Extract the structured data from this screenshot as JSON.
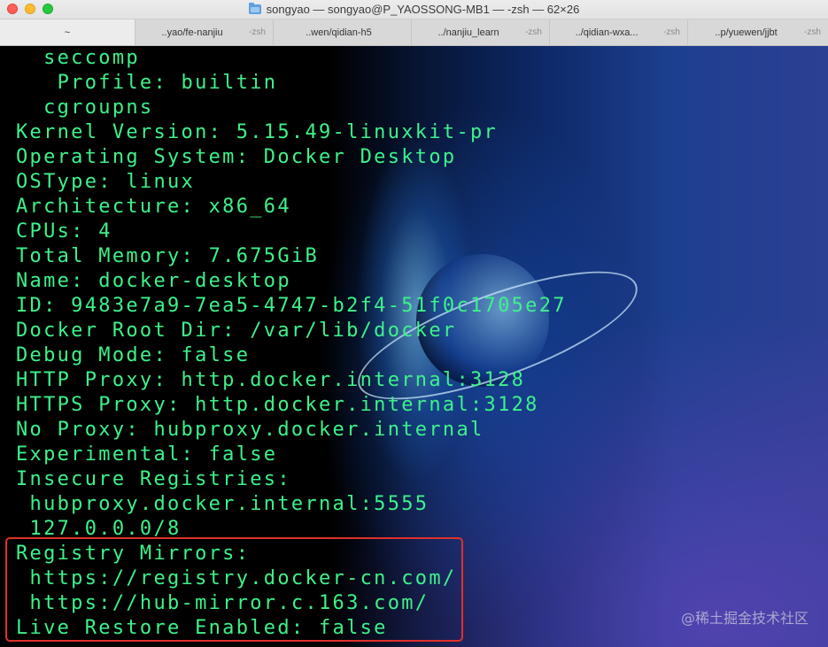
{
  "window": {
    "title": "songyao — songyao@P_YAOSSONG-MB1 — -zsh — 62×26"
  },
  "tabs": [
    {
      "title": "~",
      "shell": ""
    },
    {
      "title": "..yao/fe-nanjiu",
      "shell": "-zsh"
    },
    {
      "title": "..wen/qidian-h5",
      "shell": ""
    },
    {
      "title": "../nanjiu_learn",
      "shell": "-zsh"
    },
    {
      "title": "../qidian-wxa...",
      "shell": "-zsh"
    },
    {
      "title": "..p/yuewen/jjbt",
      "shell": "-zsh"
    }
  ],
  "terminal": {
    "lines": [
      "  seccomp",
      "   Profile: builtin",
      "  cgroupns",
      "Kernel Version: 5.15.49-linuxkit-pr",
      "Operating System: Docker Desktop",
      "OSType: linux",
      "Architecture: x86_64",
      "CPUs: 4",
      "Total Memory: 7.675GiB",
      "Name: docker-desktop",
      "ID: 9483e7a9-7ea5-4747-b2f4-51f0c1705e27",
      "Docker Root Dir: /var/lib/docker",
      "Debug Mode: false",
      "HTTP Proxy: http.docker.internal:3128",
      "HTTPS Proxy: http.docker.internal:3128",
      "No Proxy: hubproxy.docker.internal",
      "Experimental: false",
      "Insecure Registries:",
      " hubproxy.docker.internal:5555",
      " 127.0.0.0/8",
      "Registry Mirrors:",
      " https://registry.docker-cn.com/",
      " https://hub-mirror.c.163.com/",
      "Live Restore Enabled: false"
    ],
    "text_color": "#3df28a",
    "highlight_color": "#e0302a"
  },
  "watermark": "@稀土掘金技术社区"
}
